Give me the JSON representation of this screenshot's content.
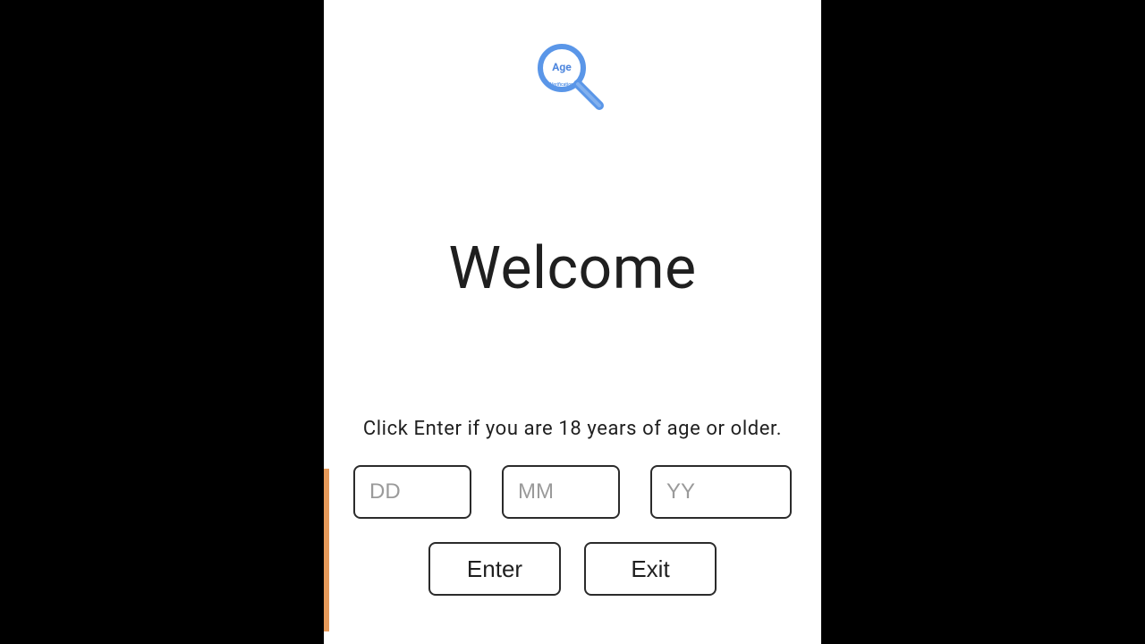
{
  "logo": {
    "top_text": "Age",
    "bottom_text": "Verification"
  },
  "heading": "Welcome",
  "instruction": "Click Enter if you are 18 years of age or older.",
  "dob": {
    "dd_placeholder": "DD",
    "mm_placeholder": "MM",
    "yy_placeholder": "YY"
  },
  "buttons": {
    "enter": "Enter",
    "exit": "Exit"
  }
}
